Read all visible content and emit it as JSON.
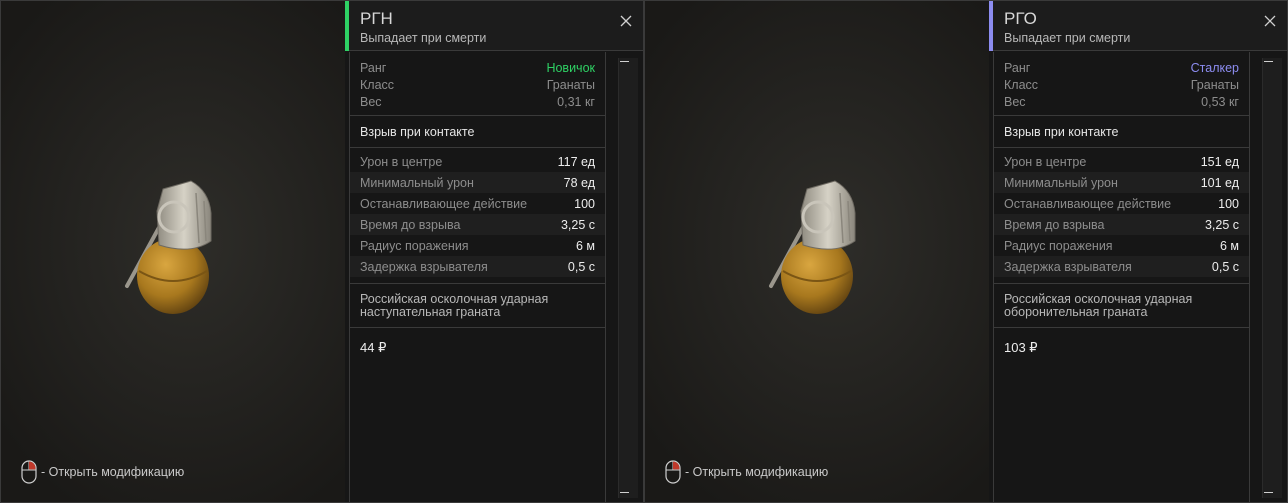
{
  "cards": [
    {
      "title": "РГН",
      "subtitle": "Выпадает при смерти",
      "accent_color": "#2ed164",
      "rank_color": "#2ed164",
      "info": [
        {
          "label": "Ранг",
          "value": "Новичок"
        },
        {
          "label": "Класс",
          "value": "Гранаты"
        },
        {
          "label": "Вес",
          "value": "0,31 кг"
        }
      ],
      "feature": "Взрыв при контакте",
      "stats": [
        {
          "label": "Урон в центре",
          "value": "117 ед"
        },
        {
          "label": "Минимальный урон",
          "value": "78 ед"
        },
        {
          "label": "Останавливающее действие",
          "value": "100"
        },
        {
          "label": "Время до взрыва",
          "value": "3,25 с"
        },
        {
          "label": "Радиус поражения",
          "value": "6 м"
        },
        {
          "label": "Задержка взрывателя",
          "value": "0,5 с"
        }
      ],
      "description": "Российская осколочная ударная наступательная граната",
      "price": "44 ₽",
      "hint": "- Открыть модификацию",
      "image_icon": "grenade-rgn-icon"
    },
    {
      "title": "РГО",
      "subtitle": "Выпадает при смерти",
      "accent_color": "#8c8cf0",
      "rank_color": "#8c8cf0",
      "info": [
        {
          "label": "Ранг",
          "value": "Сталкер"
        },
        {
          "label": "Класс",
          "value": "Гранаты"
        },
        {
          "label": "Вес",
          "value": "0,53 кг"
        }
      ],
      "feature": "Взрыв при контакте",
      "stats": [
        {
          "label": "Урон в центре",
          "value": "151 ед"
        },
        {
          "label": "Минимальный урон",
          "value": "101 ед"
        },
        {
          "label": "Останавливающее действие",
          "value": "100"
        },
        {
          "label": "Время до взрыва",
          "value": "3,25 с"
        },
        {
          "label": "Радиус поражения",
          "value": "6 м"
        },
        {
          "label": "Задержка взрывателя",
          "value": "0,5 с"
        }
      ],
      "description": "Российская осколочная ударная оборонительная граната",
      "price": "103 ₽",
      "hint": "- Открыть модификацию",
      "image_icon": "grenade-rgo-icon"
    }
  ]
}
